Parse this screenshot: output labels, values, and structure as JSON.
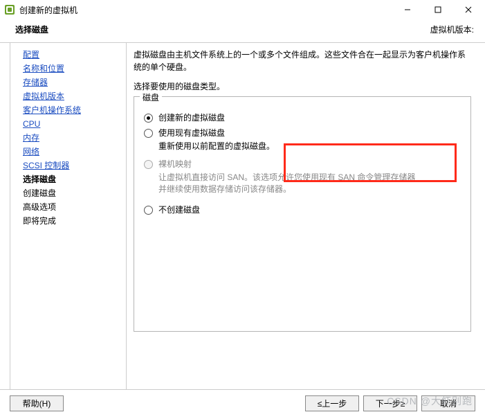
{
  "window": {
    "title": "创建新的虚拟机"
  },
  "subheader": {
    "left": "选择磁盘",
    "right": "虚拟机版本:"
  },
  "sidebar": {
    "items": [
      {
        "label": "配置",
        "state": "link"
      },
      {
        "label": "名称和位置",
        "state": "link"
      },
      {
        "label": "存储器",
        "state": "link"
      },
      {
        "label": "虚拟机版本",
        "state": "link"
      },
      {
        "label": "客户机操作系统",
        "state": "link"
      },
      {
        "label": "CPU",
        "state": "link"
      },
      {
        "label": "内存",
        "state": "link"
      },
      {
        "label": "网络",
        "state": "link"
      },
      {
        "label": "SCSI 控制器",
        "state": "link"
      },
      {
        "label": "选择磁盘",
        "state": "current"
      },
      {
        "label": "创建磁盘",
        "state": "plain"
      },
      {
        "label": "高级选项",
        "state": "plain"
      },
      {
        "label": "即将完成",
        "state": "plain"
      }
    ]
  },
  "main": {
    "description": "虚拟磁盘由主机文件系统上的一个或多个文件组成。这些文件合在一起显示为客户机操作系统的单个硬盘。",
    "subdesc": "选择要使用的磁盘类型。",
    "fieldset_legend": "磁盘",
    "options": [
      {
        "label": "创建新的虚拟磁盘",
        "sub": "",
        "checked": true,
        "disabled": false
      },
      {
        "label": "使用现有虚拟磁盘",
        "sub": "重新使用以前配置的虚拟磁盘。",
        "checked": false,
        "disabled": false
      },
      {
        "label": "裸机映射",
        "sub": "让虚拟机直接访问 SAN。该选项允许您使用现有 SAN 命令管理存储器并继续使用数据存储访问该存储器。",
        "checked": false,
        "disabled": true
      },
      {
        "label": "不创建磁盘",
        "sub": "",
        "checked": false,
        "disabled": false
      }
    ]
  },
  "footer": {
    "help": "帮助(H)",
    "back": "≤上一步",
    "next": "下一步≥",
    "cancel": "取消"
  },
  "watermark": "CSDN @大虾别跑"
}
